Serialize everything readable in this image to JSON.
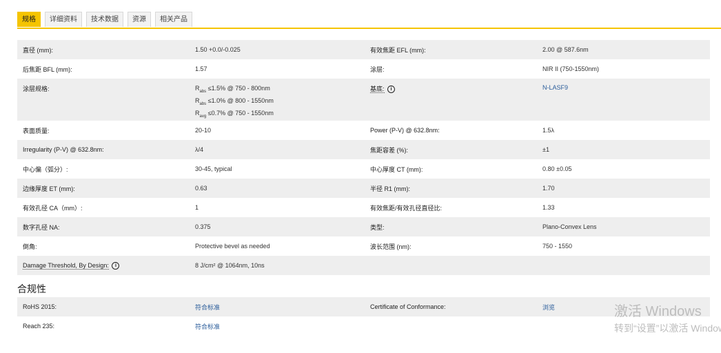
{
  "tabs": [
    "规格",
    "详细资料",
    "技术数据",
    "资源",
    "相关产品"
  ],
  "spec_rows": [
    {
      "l1": "直径 (mm):",
      "v1": "1.50 +0.0/-0.025",
      "l2": "有效焦距 EFL (mm):",
      "v2": "2.00 @ 587.6nm"
    },
    {
      "l1": "后焦距 BFL (mm):",
      "v1": "1.57",
      "l2": "涂层:",
      "v2": "NIR II (750-1550nm)"
    },
    {
      "l1": "涂层规格:",
      "v1_lines": [
        {
          "prefix": "R",
          "sub": "abs",
          "text": " ≤1.5% @ 750 - 800nm"
        },
        {
          "prefix": "R",
          "sub": "abs",
          "text": " ≤1.0% @ 800 - 1550nm"
        },
        {
          "prefix": "R",
          "sub": "avg",
          "text": " ≤0.7% @ 750 - 1550nm"
        }
      ],
      "l2": "基底:",
      "v2": "N-LASF9"
    },
    {
      "l1": "表面质量:",
      "v1": "20-10",
      "l2": "Power (P-V) @ 632.8nm:",
      "v2": "1.5λ"
    },
    {
      "l1": "Irregularity (P-V) @ 632.8nm:",
      "v1": "λ/4",
      "l2": "焦距容差 (%):",
      "v2": "±1"
    },
    {
      "l1": "中心偏（弧分）:",
      "v1": "30-45, typical",
      "l2": "中心厚度 CT (mm):",
      "v2": "0.80 ±0.05"
    },
    {
      "l1": "边缘厚度 ET (mm):",
      "v1": "0.63",
      "l2": "半径 R1 (mm):",
      "v2": "1.70"
    },
    {
      "l1": "有效孔径 CA（mm）:",
      "v1": "1",
      "l2": "有效焦距/有效孔径直径比:",
      "v2": "1.33"
    },
    {
      "l1": "数字孔径 NA:",
      "v1": "0.375",
      "l2": "类型:",
      "v2": "Plano-Convex Lens"
    },
    {
      "l1": "倒角:",
      "v1": "Protective bevel as needed",
      "l2": "波长范围 (nm):",
      "v2": "750 - 1550"
    },
    {
      "l1": "Damage Threshold, By Design:",
      "v1": "8 J/cm² @ 1064nm, 10ns",
      "l2": "",
      "v2": ""
    }
  ],
  "info_icon_glyph": "i",
  "compliance": {
    "title": "合规性",
    "rows": [
      {
        "l1": "RoHS 2015:",
        "v1": "符合标准",
        "l2": "Certificate of Conformance:",
        "v2": "浏览"
      },
      {
        "l1": "Reach 235:",
        "v1": "符合标准",
        "l2": "",
        "v2": ""
      }
    ]
  },
  "watermark": {
    "line1": "激活 Windows",
    "line2": "转到“设置”以激活 Windows。"
  },
  "colors": {
    "accent": "#f5c400",
    "link": "#2a5c9a"
  }
}
